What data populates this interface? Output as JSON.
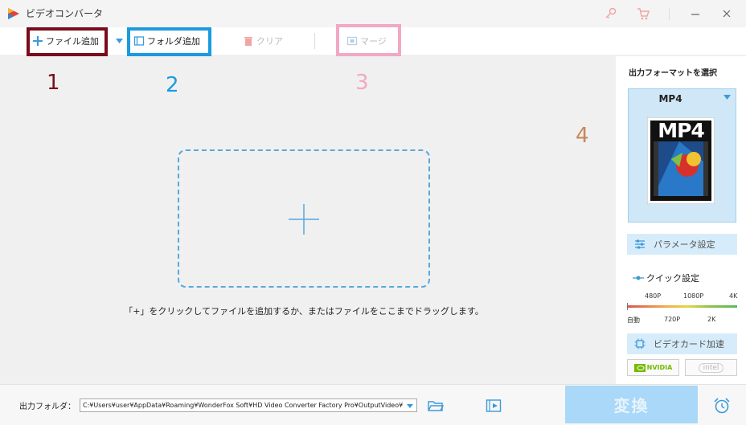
{
  "window": {
    "title": "ビデオコンバータ"
  },
  "toolbar": {
    "add_file": "ファイル追加",
    "add_folder": "フォルダ追加",
    "clear": "クリア",
    "merge": "マージ"
  },
  "annotations": [
    "1",
    "2",
    "3",
    "4"
  ],
  "colors": {
    "accent": "#3d9ad9",
    "box1": "#7a0b1b",
    "box2": "#1a9be0",
    "box3": "#f2a8c4",
    "box4": "#a67751",
    "convert": "#a9d8f8"
  },
  "main": {
    "drop_hint": "「+」をクリックしてファイルを追加するか、またはファイルをここまでドラッグします。"
  },
  "format_panel": {
    "label": "出力フォーマットを選択",
    "selected": "MP4",
    "thumb_text": "MP4",
    "param_button": "パラメータ設定",
    "quick_label": "クイック設定",
    "quality_top": [
      "480P",
      "1080P",
      "4K"
    ],
    "quality_bottom": [
      "自動",
      "720P",
      "2K"
    ],
    "gpu_button": "ビデオカード加速",
    "gpu_nvidia": "NVIDIA",
    "gpu_intel": "intel"
  },
  "bottom": {
    "output_label": "出力フォルダ：",
    "output_path": "C:¥Users¥user¥AppData¥Roaming¥WonderFox Soft¥HD Video Converter Factory Pro¥OutputVideo¥",
    "convert": "変換"
  }
}
